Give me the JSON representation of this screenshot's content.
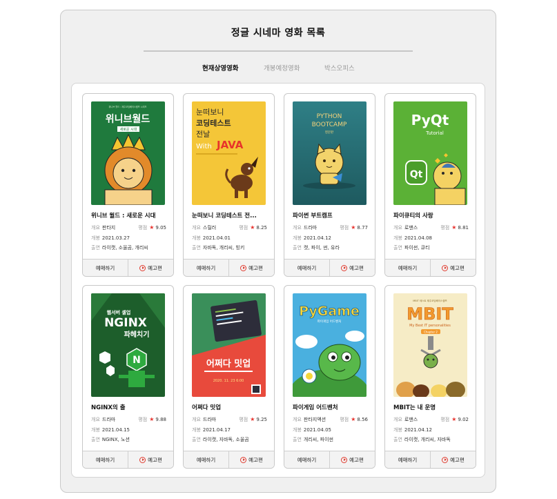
{
  "page": {
    "title": "정글 시네마 영화 목록",
    "tabs": [
      {
        "label": "현재상영영화",
        "active": true
      },
      {
        "label": "개봉예정영화",
        "active": false
      },
      {
        "label": "박스오피스",
        "active": false
      }
    ]
  },
  "labels": {
    "genre": "개요",
    "rating": "평점",
    "release": "개봉",
    "cast": "출연",
    "book_button": "예매하기",
    "trailer_button": "예고편"
  },
  "colors": {
    "accent": "#e8332e",
    "panel_bg": "#f0f0f0"
  },
  "movies": [
    {
      "title": "위니브 월드 : 새로운 시대",
      "genre": "판타지",
      "rating": "9.05",
      "release": "2021.03.27",
      "cast": "라이캣, 소울곰, 개리씨",
      "poster": {
        "title": "위니브월드",
        "subtitle": "새로운 시대",
        "top_text": "위니브 월드 : 제주코딩베이스캠프 시리즈"
      }
    },
    {
      "title": "눈떠보니 코딩테스트 전...",
      "genre": "스릴러",
      "rating": "8.25",
      "release": "2021.04.01",
      "cast": "자바독, 개리씨, 빙키",
      "poster": {
        "line1": "눈떠보니",
        "line2": "코딩테스트",
        "line3": "전날",
        "line4a": "With",
        "line4b": "JAVA"
      }
    },
    {
      "title": "파이썬 부트캠프",
      "genre": "드라마",
      "rating": "8.77",
      "release": "2021.04.12",
      "cast": "캣, 파이, 썬, 유라",
      "poster": {
        "line1": "PYTHON",
        "line2": "BOOTCAMP",
        "line3": "영문판"
      }
    },
    {
      "title": "파이큐티의 사랑",
      "genre": "로맨스",
      "rating": "8.81",
      "release": "2021.04.08",
      "cast": "파이썬, 큐티",
      "poster": {
        "line1": "PyQt",
        "line2": "Tutorial",
        "badge": "Qt"
      }
    },
    {
      "title": "NGINX의 출",
      "genre": "드라마",
      "rating": "9.88",
      "release": "2021.04.15",
      "cast": "NGINX, 노션",
      "poster": {
        "line1": "웹서버 셀업",
        "line2": "NGINX",
        "line3": "파헤치기",
        "badge": "N"
      }
    },
    {
      "title": "어쩌다 밋업",
      "genre": "드라마",
      "rating": "9.25",
      "release": "2021.04.17",
      "cast": "라이캣, 자바독, 소울곰",
      "poster": {
        "line1": "어쩌다 밋업",
        "line2": "2020. 11. 23 6:00"
      }
    },
    {
      "title": "파이게임 어드벤처",
      "genre": "판타지액션",
      "rating": "8.56",
      "release": "2021.04.05",
      "cast": "개리씨, 파이썬",
      "poster": {
        "line1": "PyGame",
        "line2": "파이게임 어드벤처"
      }
    },
    {
      "title": "MBIT는 내 운명",
      "genre": "로맨스",
      "rating": "9.02",
      "release": "2021.04.12",
      "cast": "라이캣, 개리씨, 자바독",
      "poster": {
        "line1": "MBIT",
        "line2": "My Best IT personalities",
        "line3": "Chapter 2",
        "top_text": "MBIT 테스트 제주코딩베이스캠프"
      }
    }
  ]
}
